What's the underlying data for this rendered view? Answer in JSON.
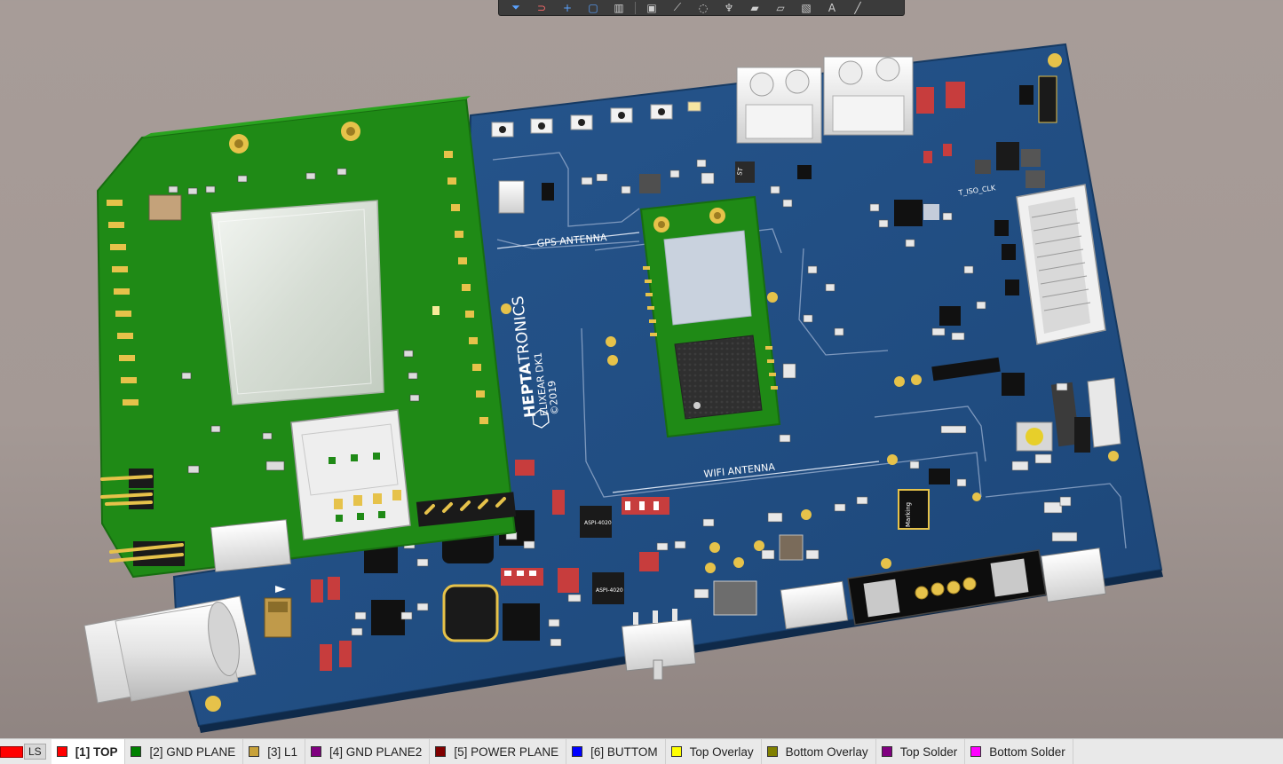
{
  "toolbar": {
    "icons": [
      "filter-icon",
      "route-icon",
      "add-icon",
      "select-rect-icon",
      "chart-icon",
      "component-icon",
      "track-icon",
      "via-icon",
      "pad-icon",
      "fill-icon",
      "region-icon",
      "dimension-icon",
      "text-icon",
      "line-icon"
    ],
    "glyphs": [
      "⏷",
      "⊃",
      "+",
      "▢",
      "▥",
      "▣",
      "⟋",
      "◌",
      "♆",
      "▰",
      "▱",
      "▧",
      "A",
      "╱"
    ]
  },
  "board": {
    "silk_labels": {
      "gps_antenna": "GPS ANTENNA",
      "wifi_antenna": "WIFI ANTENNA",
      "brand_bold": "HEPTA",
      "brand_light": "TRONICS",
      "product": "ELIXEAR DK1",
      "copyright": "©2019",
      "net_label": "T_ISO_CLK",
      "chip_marking": "Marking",
      "ic_label_1": "ASPI-4020",
      "ic_label_2": "ASPI-4020",
      "st_logo": "ST"
    },
    "colors": {
      "board": "#1f4f86",
      "module": "#1f8a16",
      "module_dark": "#176d10",
      "silk": "#ffffff",
      "gold": "#e6c24a"
    }
  },
  "layer_bar": {
    "ls_label": "LS",
    "ls_color": "#ff0000",
    "layers": [
      {
        "label": "[1] TOP",
        "color": "#ff0000",
        "active": true
      },
      {
        "label": "[2] GND PLANE",
        "color": "#008000",
        "active": false
      },
      {
        "label": "[3] L1",
        "color": "#c8a23a",
        "active": false
      },
      {
        "label": "[4] GND PLANE2",
        "color": "#800080",
        "active": false
      },
      {
        "label": "[5] POWER PLANE",
        "color": "#800000",
        "active": false
      },
      {
        "label": "[6] BUTTOM",
        "color": "#0000ff",
        "active": false
      },
      {
        "label": "Top Overlay",
        "color": "#ffff00",
        "active": false
      },
      {
        "label": "Bottom Overlay",
        "color": "#808000",
        "active": false
      },
      {
        "label": "Top Solder",
        "color": "#800080",
        "active": false
      },
      {
        "label": "Bottom Solder",
        "color": "#ff00ff",
        "active": false
      }
    ]
  }
}
